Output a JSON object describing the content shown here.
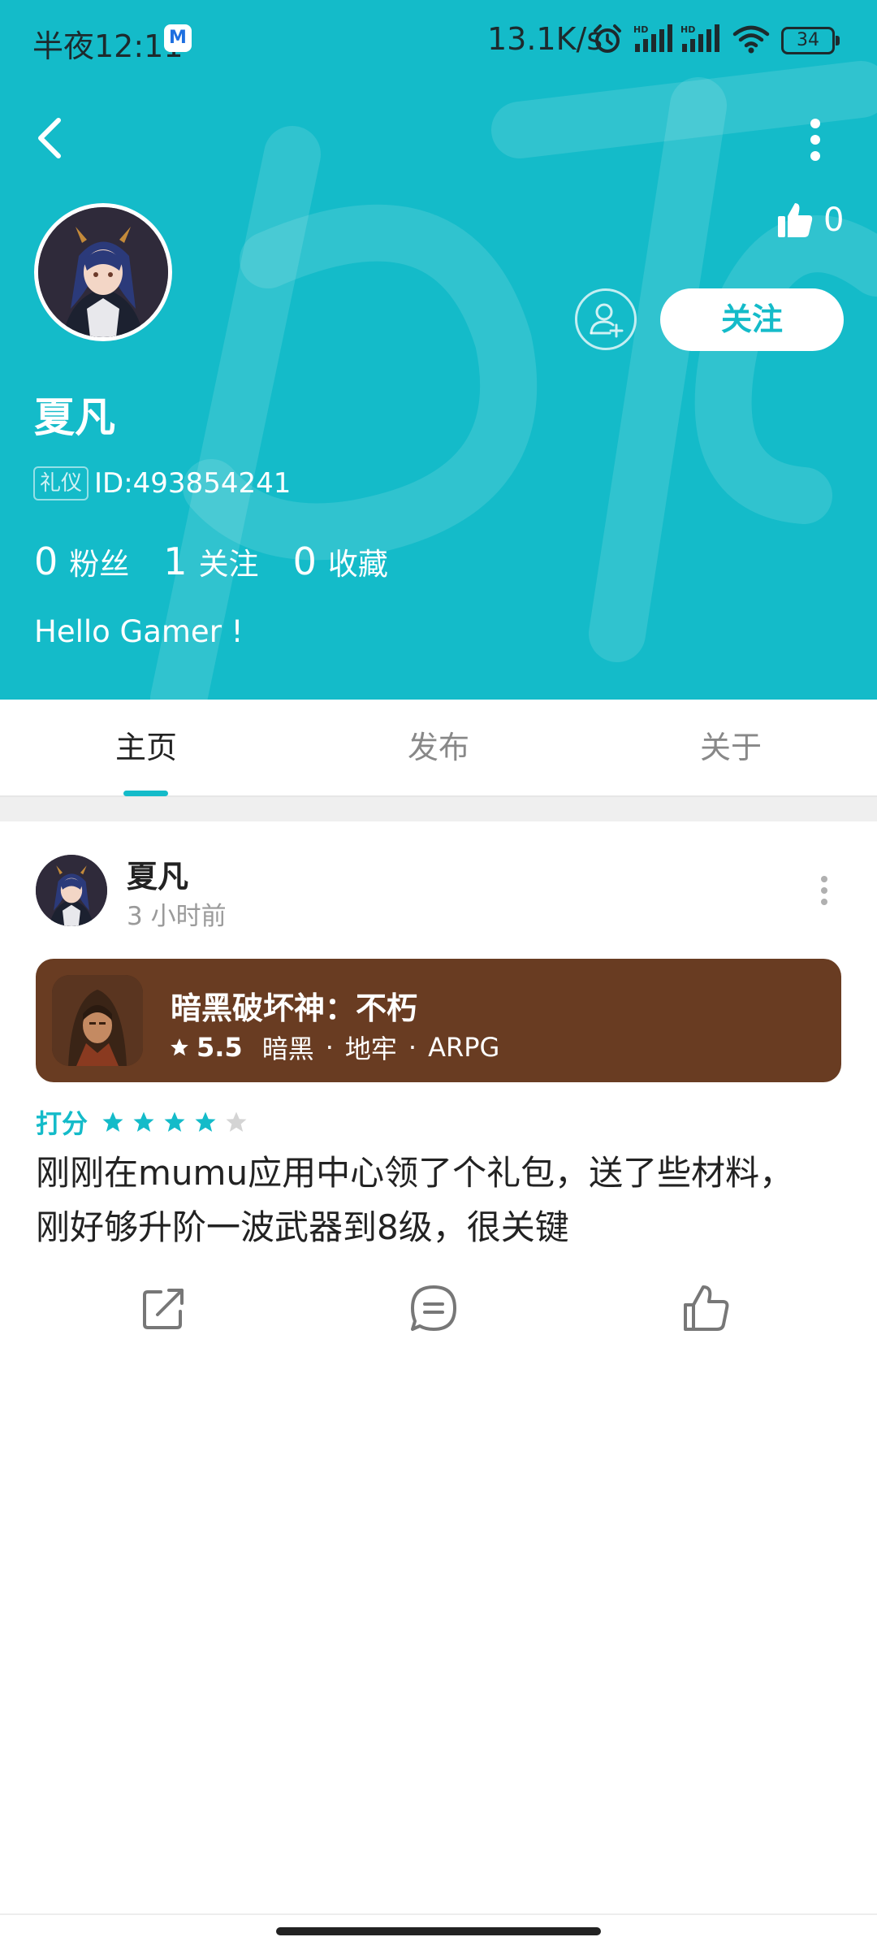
{
  "status_bar": {
    "time": "半夜12:11",
    "notif_app": "M",
    "net_speed": "13.1K/s",
    "battery": "34"
  },
  "header": {
    "like_count": "0",
    "follow_label": "关注",
    "username": "夏凡",
    "badge": "礼仪",
    "user_id": "ID:493854241",
    "stats": [
      {
        "num": "0",
        "label": "粉丝"
      },
      {
        "num": "1",
        "label": "关注"
      },
      {
        "num": "0",
        "label": "收藏"
      }
    ],
    "bio": "Hello Gamer !"
  },
  "tabs": [
    {
      "label": "主页",
      "active": true
    },
    {
      "label": "发布",
      "active": false
    },
    {
      "label": "关于",
      "active": false
    }
  ],
  "post": {
    "author": "夏凡",
    "time": "3 小时前",
    "game": {
      "title": "暗黑破坏神：不朽",
      "score": "5.5",
      "tags": [
        "暗黑",
        "地牢",
        "ARPG"
      ]
    },
    "rating_label": "打分",
    "rating_stars": 4,
    "rating_max": 5,
    "text_lines": [
      "刚刚在mumu应用中心领了个礼包，送了些材料，",
      "刚好够升阶一波武器到8级，很关键"
    ]
  },
  "colors": {
    "accent": "#14bbc9",
    "card": "#693c22"
  }
}
